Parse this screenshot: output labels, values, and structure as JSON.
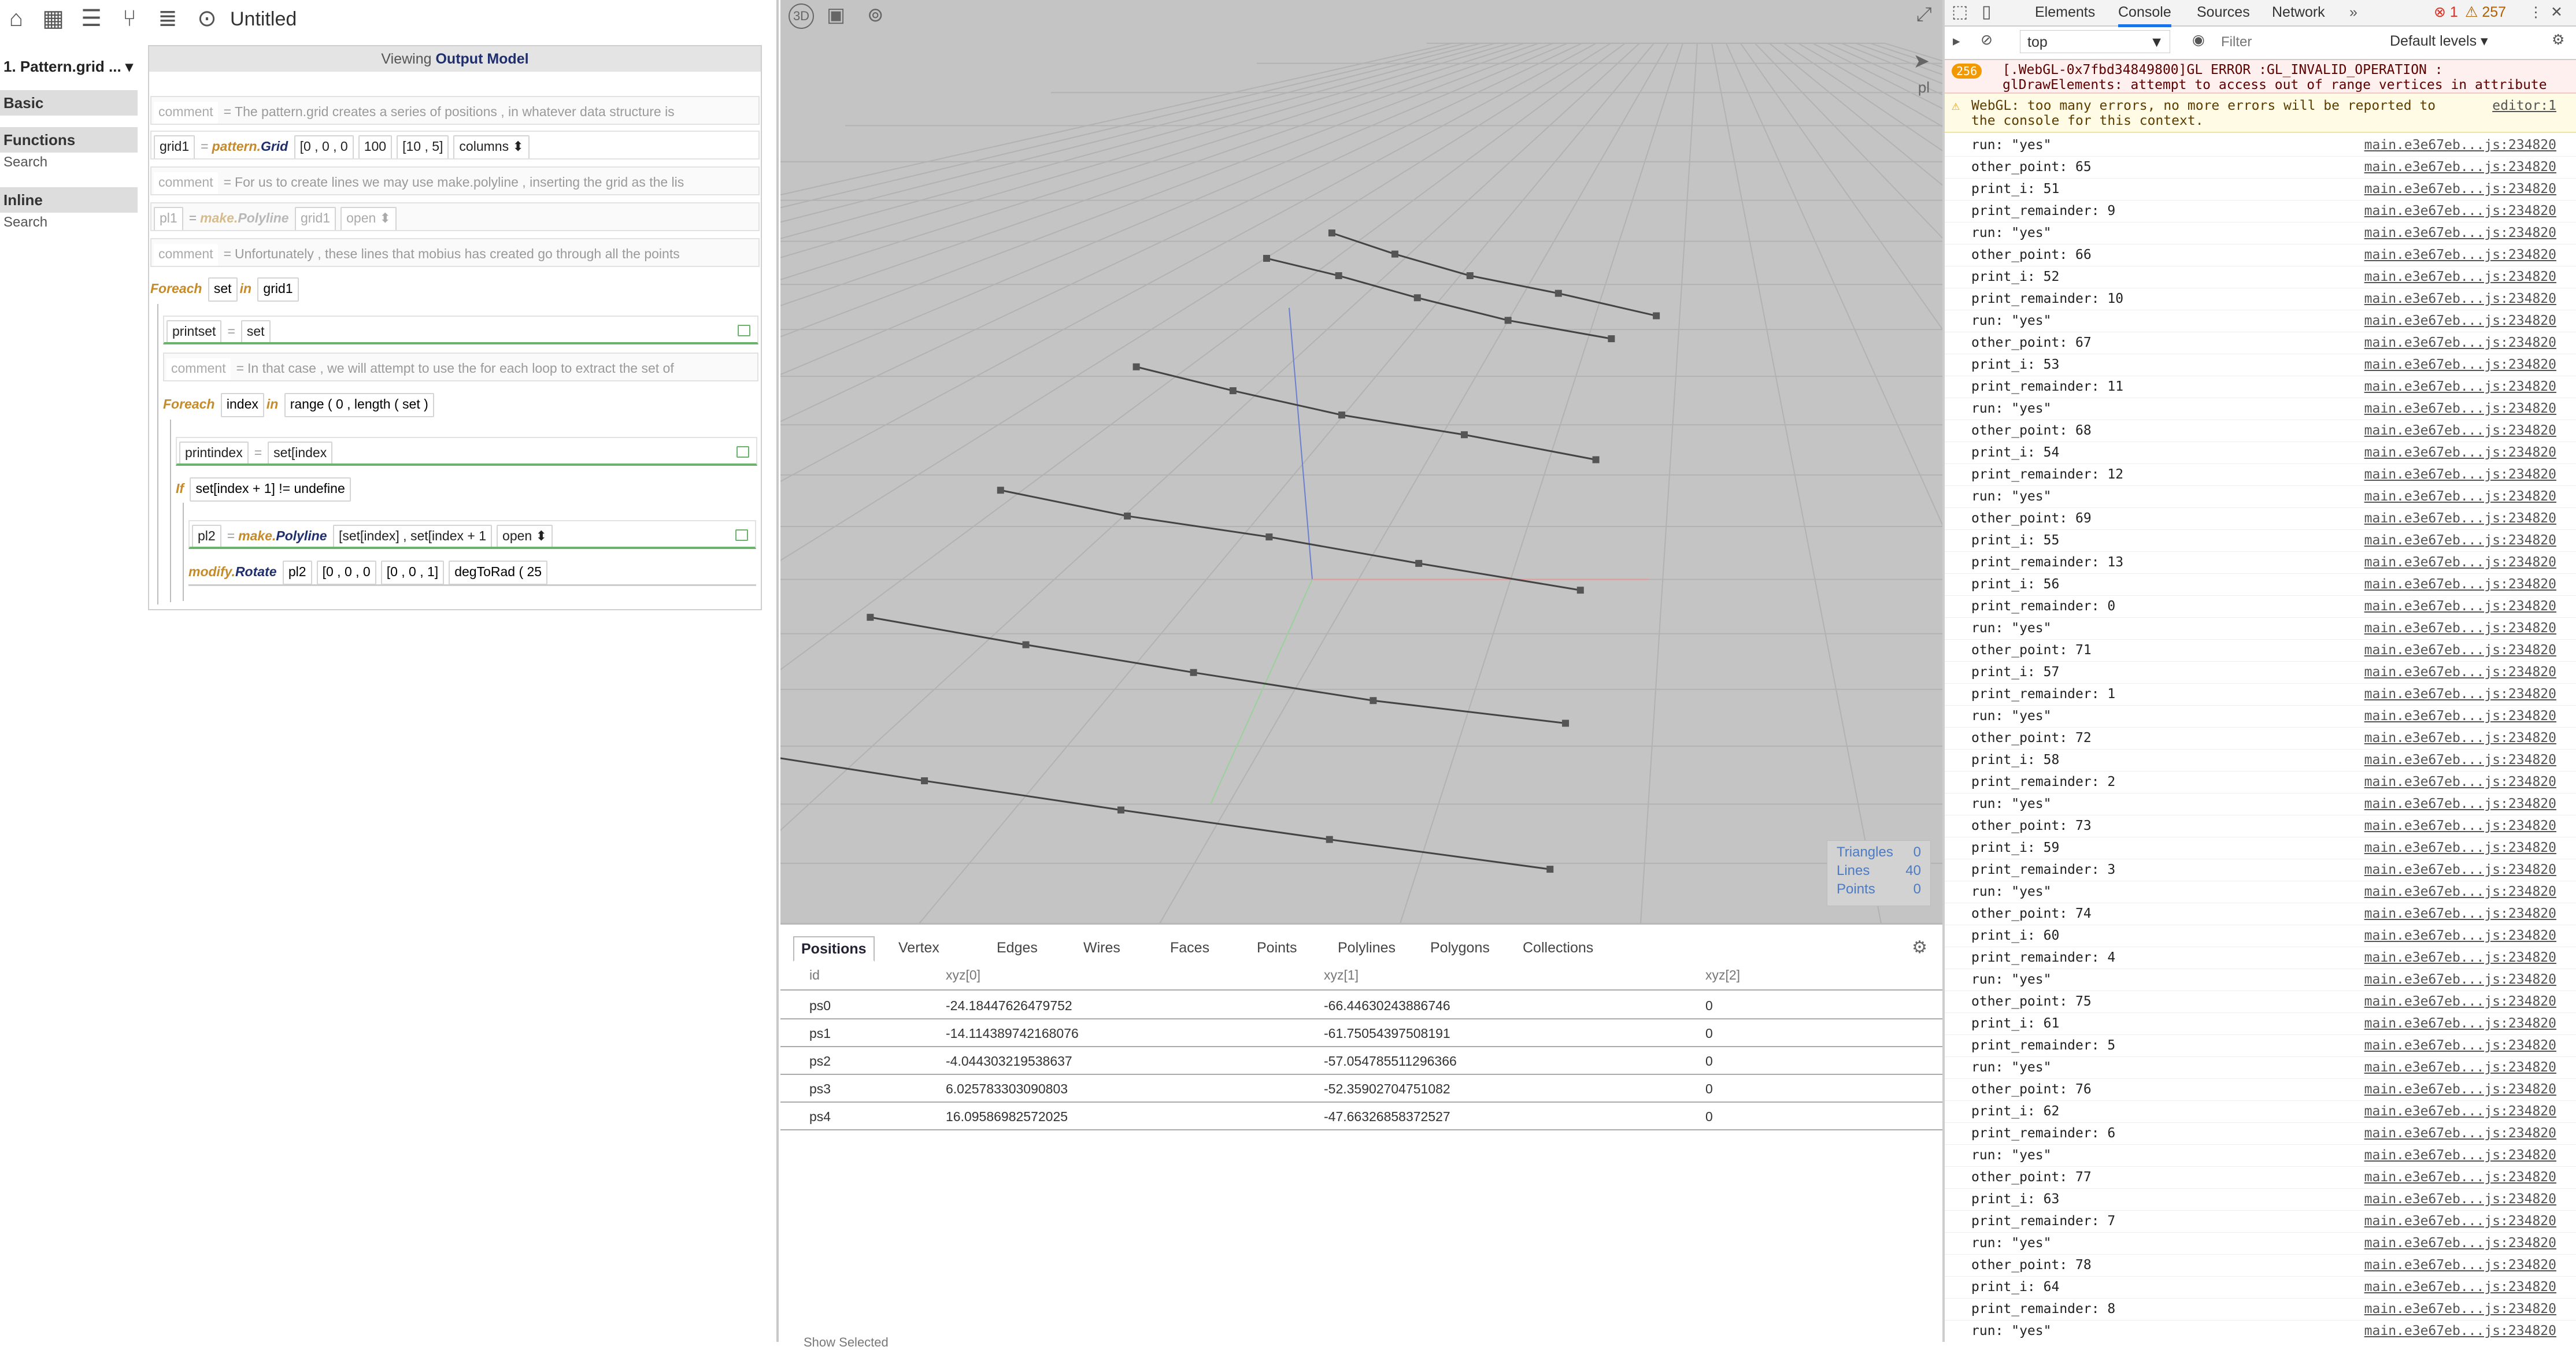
{
  "toolbar": {
    "file_title": "Untitled"
  },
  "procedure": {
    "function_select": "1. Pattern.grid ...",
    "sections": [
      {
        "label": "Basic"
      },
      {
        "label": "Functions",
        "search": "Search"
      },
      {
        "label": "Inline",
        "search": "Search"
      }
    ]
  },
  "editor": {
    "viewing_prefix": "Viewing",
    "viewing_model": "Output Model",
    "rows": {
      "c1_label": "comment",
      "c1_text": "The pattern.grid creates a series of positions , in whatever data structure is",
      "grid_var": "grid1",
      "grid_mod": "pattern.",
      "grid_fn": "Grid",
      "grid_a1": "[0 , 0 , 0",
      "grid_a2": "100",
      "grid_a3": "[10 , 5]",
      "grid_a4": "columns",
      "c2_label": "comment",
      "c2_text": "For us to create lines we may use make.polyline , inserting the grid as the lis",
      "pl_var": "pl1",
      "pl_mod": "make.",
      "pl_fn": "Polyline",
      "pl_a1": "grid1",
      "pl_a2": "open",
      "c3_label": "comment",
      "c3_text": "Unfortunately , these lines that mobius has created go through all the points",
      "fe1_kw": "Foreach",
      "fe1_var": "set",
      "fe1_in": "in",
      "fe1_iter": "grid1",
      "ps_var": "printset",
      "ps_val": "set",
      "c4_label": "comment",
      "c4_text": "In that case , we will attempt to use the for each loop to extract the set of",
      "fe2_kw": "Foreach",
      "fe2_var": "index",
      "fe2_in": "in",
      "fe2_iter": "range ( 0 , length ( set )",
      "pi_var": "printindex",
      "pi_val": "set[index",
      "if_kw": "If",
      "if_cond": "set[index + 1] != undefine",
      "pl2_var": "pl2",
      "pl2_mod": "make.",
      "pl2_fn": "Polyline",
      "pl2_a1": "[set[index] , set[index + 1",
      "pl2_a2": "open",
      "rot_mod": "modify.",
      "rot_fn": "Rotate",
      "rot_a1": "pl2",
      "rot_a2": "[0 , 0 , 0",
      "rot_a3": "[0 , 0 , 1]",
      "rot_a4": "degToRad ( 25"
    }
  },
  "viewer": {
    "mode_label": "3D",
    "side_label": "pl",
    "stats": {
      "triangles_label": "Triangles",
      "triangles": "0",
      "lines_label": "Lines",
      "lines": "40",
      "points_label": "Points",
      "points": "0"
    },
    "polylines": [
      [
        [
          -24,
          -66
        ],
        [
          -14,
          -62
        ],
        [
          -4,
          -57
        ],
        [
          6,
          -52
        ],
        [
          16,
          -48
        ]
      ],
      [
        [
          -24,
          -42
        ],
        [
          -14,
          -37
        ],
        [
          -4,
          -32
        ],
        [
          6,
          -28
        ],
        [
          16,
          -23
        ]
      ],
      [
        [
          -24,
          -17
        ],
        [
          -14,
          -12
        ],
        [
          -4,
          -8
        ],
        [
          6,
          -3
        ],
        [
          16,
          2
        ]
      ],
      [
        [
          -24,
          7
        ],
        [
          -14,
          12
        ],
        [
          -4,
          17
        ],
        [
          6,
          22
        ],
        [
          16,
          26
        ]
      ],
      [
        [
          -24,
          31
        ],
        [
          -14,
          36
        ],
        [
          -4,
          41
        ],
        [
          6,
          46
        ],
        [
          16,
          51
        ]
      ],
      [
        [
          -20,
          -72
        ],
        [
          -10,
          -67
        ],
        [
          0,
          -62
        ],
        [
          10,
          -58
        ],
        [
          20,
          -53
        ]
      ]
    ]
  },
  "tables": {
    "tabs": [
      "Positions",
      "Vertex",
      "Edges",
      "Wires",
      "Faces",
      "Points",
      "Polylines",
      "Polygons",
      "Collections"
    ],
    "columns": [
      "id",
      "xyz[0]",
      "xyz[1]",
      "xyz[2]"
    ],
    "rows": [
      [
        "ps0",
        "-24.18447626479752",
        "-66.44630243886746",
        "0"
      ],
      [
        "ps1",
        "-14.114389742168076",
        "-61.75054397508191",
        "0"
      ],
      [
        "ps2",
        "-4.044303219538637",
        "-57.054785511296366",
        "0"
      ],
      [
        "ps3",
        "6.025783303090803",
        "-52.35902704751082",
        "0"
      ],
      [
        "ps4",
        "16.09586982572025",
        "-47.66326858372527",
        "0"
      ]
    ],
    "show_selected": "Show Selected"
  },
  "devtools": {
    "tabs": [
      "Elements",
      "Console",
      "Sources",
      "Network"
    ],
    "error_count": "1",
    "warning_count": "257",
    "context": "top",
    "filter_placeholder": "Filter",
    "levels": "Default levels",
    "error_badge": "256",
    "error_text": "[.WebGL-0x7fbd34849800]GL ERROR :GL_INVALID_OPERATION : glDrawElements: attempt to access out of range vertices in attribute 1",
    "warning_text": "WebGL: too many errors, no more errors will be reported to the console for this context.",
    "warning_src": "editor:1",
    "log_src": "main.e3e67eb...js:234820",
    "logs": [
      "run: \"yes\"",
      "other_point: 65",
      "print_i: 51",
      "print_remainder: 9",
      "run: \"yes\"",
      "other_point: 66",
      "print_i: 52",
      "print_remainder: 10",
      "run: \"yes\"",
      "other_point: 67",
      "print_i: 53",
      "print_remainder: 11",
      "run: \"yes\"",
      "other_point: 68",
      "print_i: 54",
      "print_remainder: 12",
      "run: \"yes\"",
      "other_point: 69",
      "print_i: 55",
      "print_remainder: 13",
      "print_i: 56",
      "print_remainder: 0",
      "run: \"yes\"",
      "other_point: 71",
      "print_i: 57",
      "print_remainder: 1",
      "run: \"yes\"",
      "other_point: 72",
      "print_i: 58",
      "print_remainder: 2",
      "run: \"yes\"",
      "other_point: 73",
      "print_i: 59",
      "print_remainder: 3",
      "run: \"yes\"",
      "other_point: 74",
      "print_i: 60",
      "print_remainder: 4",
      "run: \"yes\"",
      "other_point: 75",
      "print_i: 61",
      "print_remainder: 5",
      "run: \"yes\"",
      "other_point: 76",
      "print_i: 62",
      "print_remainder: 6",
      "run: \"yes\"",
      "other_point: 77",
      "print_i: 63",
      "print_remainder: 7",
      "run: \"yes\"",
      "other_point: 78",
      "print_i: 64",
      "print_remainder: 8",
      "run: \"yes\""
    ]
  }
}
